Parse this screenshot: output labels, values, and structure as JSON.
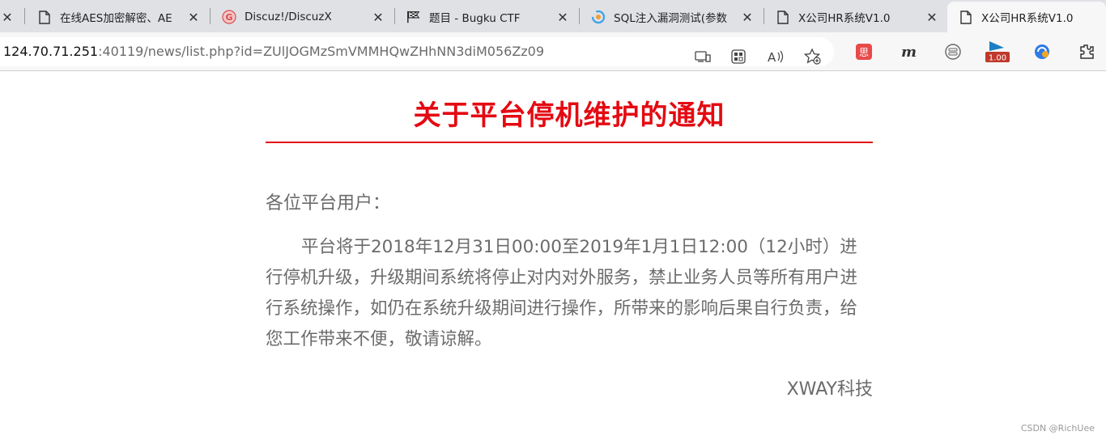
{
  "browser": {
    "tabs": [
      {
        "title": "",
        "icon": "close-icon"
      },
      {
        "title": "在线AES加密解密、AE",
        "icon": "page-icon"
      },
      {
        "title": "Discuz!/DiscuzX",
        "icon": "discuz-icon"
      },
      {
        "title": "题目 - Bugku CTF",
        "icon": "flag-icon"
      },
      {
        "title": "SQL注入漏洞测试(参数",
        "icon": "mozhe-icon"
      },
      {
        "title": "X公司HR系统V1.0",
        "icon": "page-icon"
      },
      {
        "title": "X公司HR系统V1.0",
        "icon": "page-icon",
        "active": true
      }
    ],
    "address": {
      "host": "124.70.71.251",
      "path": ":40119/news/list.php?id=ZUlJOGMzSmVMMHQwZHhNN3diM056Zz09"
    },
    "extension_badge": "1.00",
    "toolbar_icons": [
      "immersive-reader-icon",
      "apps-icon",
      "read-aloud-icon",
      "favorite-add-icon",
      "extension-red-icon",
      "m-icon",
      "tab-icon",
      "speed-badge-icon",
      "translate-icon",
      "extensions-icon"
    ]
  },
  "notice": {
    "title": "关于平台停机维护的通知",
    "greeting": "各位平台用户：",
    "body": "平台将于2018年12月31日00:00至2019年1月1日12:00（12小时）进行停机升级，升级期间系统将停止对内对外服务，禁止业务人员等所有用户进行系统操作，如仍在系统升级期间进行操作，所带来的影响后果自行负责，给您工作带来不便，敬请谅解。",
    "signature": "XWAY科技"
  },
  "watermark": "CSDN @RichUee",
  "colors": {
    "title_red": "#e40a12",
    "body_gray": "#6b6b6b",
    "tabstrip": "#dfe1e5"
  }
}
